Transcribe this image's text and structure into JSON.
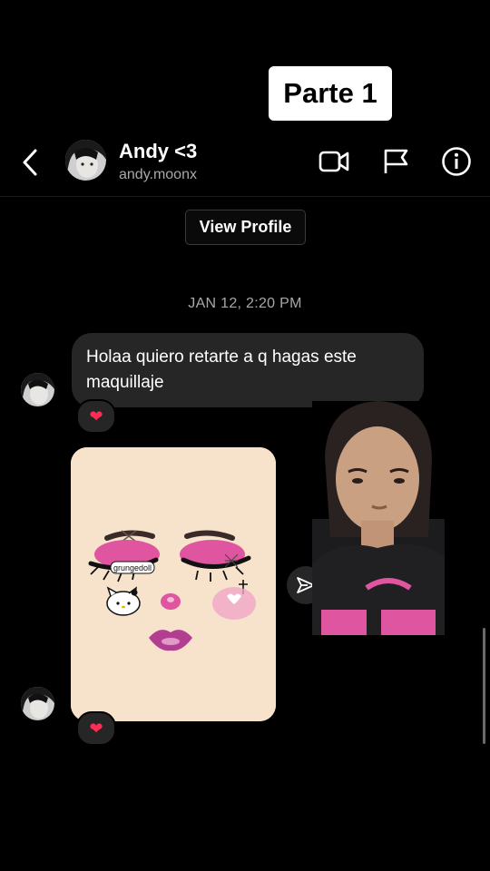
{
  "overlay": {
    "label": "Parte 1"
  },
  "header": {
    "name": "Andy <3",
    "handle": "andy.moonx",
    "icons": [
      "back-chevron-icon",
      "video-call-icon",
      "flag-icon",
      "info-icon"
    ]
  },
  "view_profile_label": "View Profile",
  "timestamp": "JAN 12, 2:20 PM",
  "messages": [
    {
      "text": "Holaa quiero retarte a q hagas este maquillaje",
      "reaction": "❤"
    },
    {
      "type": "image",
      "caption_on_image": "grungedoll",
      "reaction": "❤"
    }
  ],
  "colors": {
    "background": "#000000",
    "bubble": "#262626",
    "secondary_text": "#a8a8a8",
    "heart": "#ff2d55",
    "accent_pink": "#e0559f"
  }
}
